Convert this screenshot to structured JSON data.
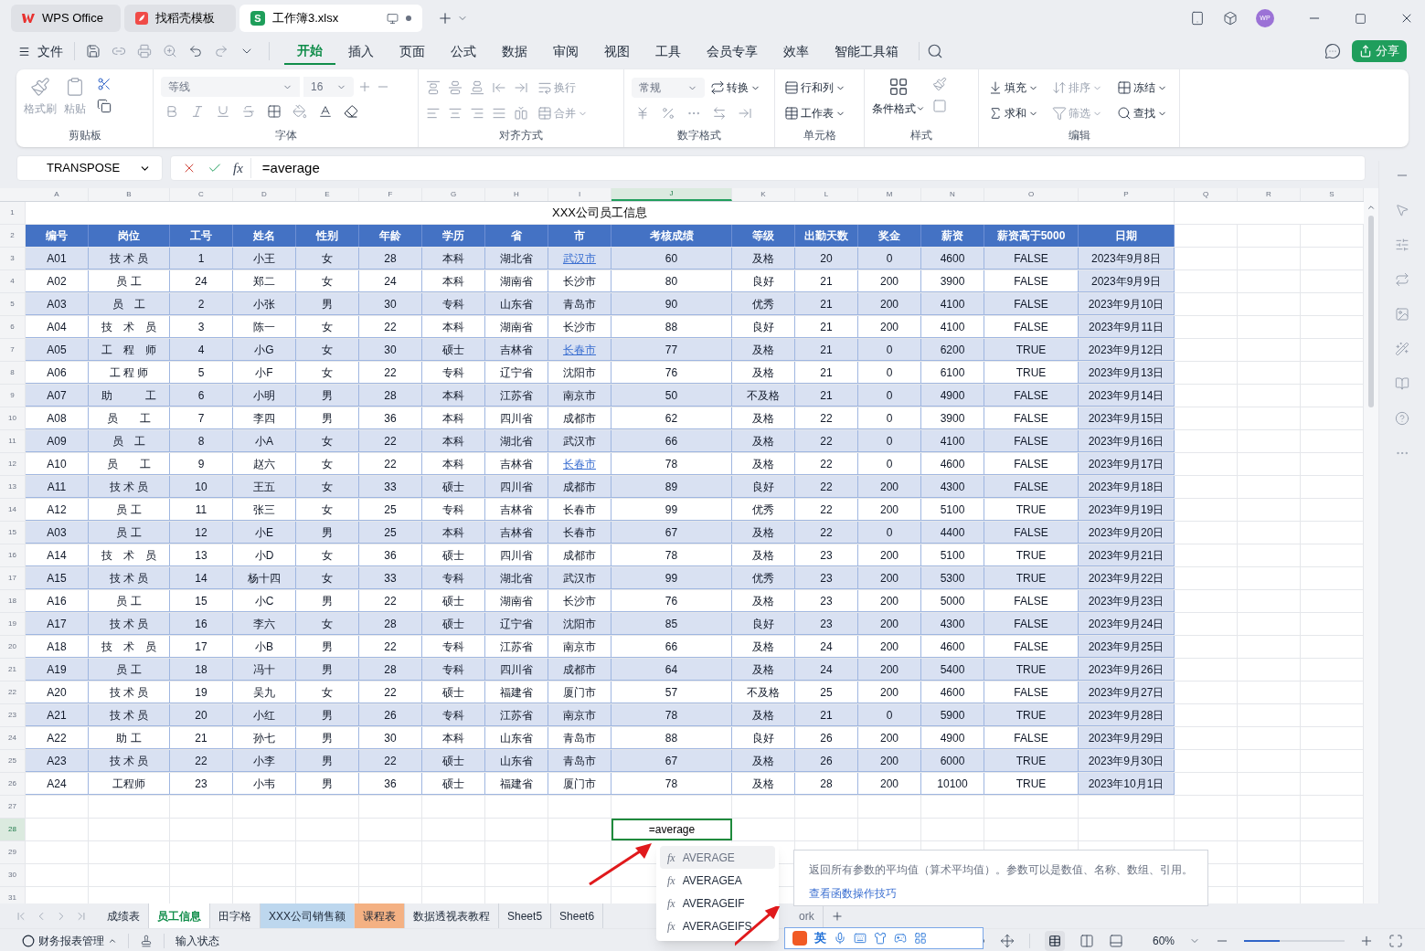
{
  "app_tabs": [
    {
      "label": "WPS Office",
      "selected": false,
      "kind": "wps"
    },
    {
      "label": "找稻壳模板",
      "selected": false,
      "kind": "docer"
    },
    {
      "label": "工作簿3.xlsx",
      "selected": true,
      "kind": "sheet",
      "badge": "S"
    }
  ],
  "avatar": "WP",
  "menu": {
    "file": "文件",
    "tabs": [
      {
        "label": "开始",
        "selected": true
      },
      {
        "label": "插入",
        "selected": false
      },
      {
        "label": "页面",
        "selected": false
      },
      {
        "label": "公式",
        "selected": false
      },
      {
        "label": "数据",
        "selected": false
      },
      {
        "label": "审阅",
        "selected": false
      },
      {
        "label": "视图",
        "selected": false
      },
      {
        "label": "工具",
        "selected": false
      },
      {
        "label": "会员专享",
        "selected": false
      },
      {
        "label": "效率",
        "selected": false
      },
      {
        "label": "智能工具箱",
        "selected": false
      }
    ],
    "share": "分享"
  },
  "ribbon": {
    "clipboard": {
      "title": "剪贴板",
      "format_painter": {
        "label": "格式刷",
        "disabled": true
      },
      "paste": {
        "label": "粘贴",
        "disabled": true
      }
    },
    "font": {
      "title": "字体",
      "font_name": "等线",
      "font_size": "16"
    },
    "alignment": {
      "title": "对齐方式",
      "wrap": {
        "label": "换行",
        "disabled": true
      },
      "merge": {
        "label": "合并",
        "disabled": true
      }
    },
    "number": {
      "title": "数字格式",
      "format": "常规",
      "convert": "转换"
    },
    "cells": {
      "title": "单元格",
      "rows_cols": "行和列",
      "worksheet": "工作表"
    },
    "styles": {
      "title": "样式",
      "conditional": "条件格式"
    },
    "editing": {
      "title": "编辑",
      "items": [
        {
          "label": "填充",
          "disabled": false
        },
        {
          "label": "排序",
          "disabled": true
        },
        {
          "label": "冻结",
          "disabled": false
        },
        {
          "label": "求和",
          "disabled": false
        },
        {
          "label": "筛选",
          "disabled": true
        },
        {
          "label": "查找",
          "disabled": false
        }
      ]
    }
  },
  "formula_bar": {
    "name_box": "TRANSPOSE",
    "fx": "fx",
    "formula": "=average"
  },
  "sheet": {
    "columns": [
      {
        "label": "A",
        "selected": false
      },
      {
        "label": "B",
        "selected": false
      },
      {
        "label": "C",
        "selected": false
      },
      {
        "label": "D",
        "selected": false
      },
      {
        "label": "E",
        "selected": false
      },
      {
        "label": "F",
        "selected": false
      },
      {
        "label": "G",
        "selected": false
      },
      {
        "label": "H",
        "selected": false
      },
      {
        "label": "I",
        "selected": false
      },
      {
        "label": "J",
        "selected": true
      },
      {
        "label": "K",
        "selected": false
      },
      {
        "label": "L",
        "selected": false
      },
      {
        "label": "M",
        "selected": false
      },
      {
        "label": "N",
        "selected": false
      },
      {
        "label": "O",
        "selected": false
      },
      {
        "label": "P",
        "selected": false
      },
      {
        "label": "Q",
        "selected": false
      },
      {
        "label": "R",
        "selected": false
      },
      {
        "label": "S",
        "selected": false
      }
    ],
    "row_numbers": [
      {
        "label": "1",
        "selected": false
      },
      {
        "label": "2",
        "selected": false
      },
      {
        "label": "3",
        "selected": false
      },
      {
        "label": "4",
        "selected": false
      },
      {
        "label": "5",
        "selected": false
      },
      {
        "label": "6",
        "selected": false
      },
      {
        "label": "7",
        "selected": false
      },
      {
        "label": "8",
        "selected": false
      },
      {
        "label": "9",
        "selected": false
      },
      {
        "label": "10",
        "selected": false
      },
      {
        "label": "11",
        "selected": false
      },
      {
        "label": "12",
        "selected": false
      },
      {
        "label": "13",
        "selected": false
      },
      {
        "label": "14",
        "selected": false
      },
      {
        "label": "15",
        "selected": false
      },
      {
        "label": "16",
        "selected": false
      },
      {
        "label": "17",
        "selected": false
      },
      {
        "label": "18",
        "selected": false
      },
      {
        "label": "19",
        "selected": false
      },
      {
        "label": "20",
        "selected": false
      },
      {
        "label": "21",
        "selected": false
      },
      {
        "label": "22",
        "selected": false
      },
      {
        "label": "23",
        "selected": false
      },
      {
        "label": "24",
        "selected": false
      },
      {
        "label": "25",
        "selected": false
      },
      {
        "label": "26",
        "selected": false
      },
      {
        "label": "27",
        "selected": false
      },
      {
        "label": "28",
        "selected": true
      },
      {
        "label": "29",
        "selected": false
      },
      {
        "label": "30",
        "selected": false
      },
      {
        "label": "31",
        "selected": false
      }
    ],
    "title": "XXX公司员工信息",
    "headers": [
      "编号",
      "岗位",
      "工号",
      "姓名",
      "性别",
      "年龄",
      "学历",
      "省",
      "市",
      "考核成绩",
      "等级",
      "出勤天数",
      "奖金",
      "薪资",
      "薪资高于5000",
      "日期"
    ],
    "rows": [
      {
        "cells": [
          "A01",
          "技 术 员",
          "1",
          "小王",
          "女",
          "28",
          "本科",
          "湖北省",
          "武汉市",
          "60",
          "及格",
          "20",
          "0",
          "4600",
          "FALSE",
          "2023年9月8日"
        ],
        "city_link": true
      },
      {
        "cells": [
          "A02",
          "员 工",
          "24",
          "郑二",
          "女",
          "24",
          "本科",
          "湖南省",
          "长沙市",
          "80",
          "良好",
          "21",
          "200",
          "3900",
          "FALSE",
          "2023年9月9日"
        ],
        "city_link": false
      },
      {
        "cells": [
          "A03",
          "员　工",
          "2",
          "小张",
          "男",
          "30",
          "专科",
          "山东省",
          "青岛市",
          "90",
          "优秀",
          "21",
          "200",
          "4100",
          "FALSE",
          "2023年9月10日"
        ],
        "city_link": false
      },
      {
        "cells": [
          "A04",
          "技　术　员",
          "3",
          "陈一",
          "女",
          "22",
          "本科",
          "湖南省",
          "长沙市",
          "88",
          "良好",
          "21",
          "200",
          "4100",
          "FALSE",
          "2023年9月11日"
        ],
        "city_link": false
      },
      {
        "cells": [
          "A05",
          "工　程　师",
          "4",
          "小G",
          "女",
          "30",
          "硕士",
          "吉林省",
          "长春市",
          "77",
          "及格",
          "21",
          "0",
          "6200",
          "TRUE",
          "2023年9月12日"
        ],
        "city_link": true
      },
      {
        "cells": [
          "A06",
          "工 程 师",
          "5",
          "小F",
          "女",
          "22",
          "专科",
          "辽宁省",
          "沈阳市",
          "76",
          "及格",
          "21",
          "0",
          "6100",
          "TRUE",
          "2023年9月13日"
        ],
        "city_link": false
      },
      {
        "cells": [
          "A07",
          "助　　　工",
          "6",
          "小明",
          "男",
          "28",
          "本科",
          "江苏省",
          "南京市",
          "50",
          "不及格",
          "21",
          "0",
          "4900",
          "FALSE",
          "2023年9月14日"
        ],
        "city_link": false
      },
      {
        "cells": [
          "A08",
          "员　　工",
          "7",
          "李四",
          "男",
          "36",
          "本科",
          "四川省",
          "成都市",
          "62",
          "及格",
          "22",
          "0",
          "3900",
          "FALSE",
          "2023年9月15日"
        ],
        "city_link": false
      },
      {
        "cells": [
          "A09",
          "员　工",
          "8",
          "小A",
          "女",
          "22",
          "本科",
          "湖北省",
          "武汉市",
          "66",
          "及格",
          "22",
          "0",
          "4100",
          "FALSE",
          "2023年9月16日"
        ],
        "city_link": false
      },
      {
        "cells": [
          "A10",
          "员　　工",
          "9",
          "赵六",
          "女",
          "22",
          "本科",
          "吉林省",
          "长春市",
          "78",
          "及格",
          "22",
          "0",
          "4600",
          "FALSE",
          "2023年9月17日"
        ],
        "city_link": true
      },
      {
        "cells": [
          "A11",
          "技 术 员",
          "10",
          "王五",
          "女",
          "33",
          "硕士",
          "四川省",
          "成都市",
          "89",
          "良好",
          "22",
          "200",
          "4300",
          "FALSE",
          "2023年9月18日"
        ],
        "city_link": false
      },
      {
        "cells": [
          "A12",
          "员 工",
          "11",
          "张三",
          "女",
          "25",
          "专科",
          "吉林省",
          "长春市",
          "99",
          "优秀",
          "22",
          "200",
          "5100",
          "TRUE",
          "2023年9月19日"
        ],
        "city_link": false
      },
      {
        "cells": [
          "A03",
          "员 工",
          "12",
          "小E",
          "男",
          "25",
          "本科",
          "吉林省",
          "长春市",
          "67",
          "及格",
          "22",
          "0",
          "4400",
          "FALSE",
          "2023年9月20日"
        ],
        "city_link": false
      },
      {
        "cells": [
          "A14",
          "技　术　员",
          "13",
          "小D",
          "女",
          "36",
          "硕士",
          "四川省",
          "成都市",
          "78",
          "及格",
          "23",
          "200",
          "5100",
          "TRUE",
          "2023年9月21日"
        ],
        "city_link": false
      },
      {
        "cells": [
          "A15",
          "技 术 员",
          "14",
          "杨十四",
          "女",
          "33",
          "专科",
          "湖北省",
          "武汉市",
          "99",
          "优秀",
          "23",
          "200",
          "5300",
          "TRUE",
          "2023年9月22日"
        ],
        "city_link": false
      },
      {
        "cells": [
          "A16",
          "员 工",
          "15",
          "小C",
          "男",
          "22",
          "硕士",
          "湖南省",
          "长沙市",
          "76",
          "及格",
          "23",
          "200",
          "5000",
          "FALSE",
          "2023年9月23日"
        ],
        "city_link": false
      },
      {
        "cells": [
          "A17",
          "技 术 员",
          "16",
          "李六",
          "女",
          "28",
          "硕士",
          "辽宁省",
          "沈阳市",
          "85",
          "良好",
          "23",
          "200",
          "4300",
          "FALSE",
          "2023年9月24日"
        ],
        "city_link": false
      },
      {
        "cells": [
          "A18",
          "技　术　员",
          "17",
          "小B",
          "男",
          "22",
          "专科",
          "江苏省",
          "南京市",
          "66",
          "及格",
          "24",
          "200",
          "4600",
          "FALSE",
          "2023年9月25日"
        ],
        "city_link": false
      },
      {
        "cells": [
          "A19",
          "员 工",
          "18",
          "冯十",
          "男",
          "28",
          "专科",
          "四川省",
          "成都市",
          "64",
          "及格",
          "24",
          "200",
          "5400",
          "TRUE",
          "2023年9月26日"
        ],
        "city_link": false
      },
      {
        "cells": [
          "A20",
          "技 术 员",
          "19",
          "吴九",
          "女",
          "22",
          "硕士",
          "福建省",
          "厦门市",
          "57",
          "不及格",
          "25",
          "200",
          "4600",
          "FALSE",
          "2023年9月27日"
        ],
        "city_link": false
      },
      {
        "cells": [
          "A21",
          "技 术 员",
          "20",
          "小红",
          "男",
          "26",
          "专科",
          "江苏省",
          "南京市",
          "78",
          "及格",
          "21",
          "0",
          "5900",
          "TRUE",
          "2023年9月28日"
        ],
        "city_link": false
      },
      {
        "cells": [
          "A22",
          "助 工",
          "21",
          "孙七",
          "男",
          "30",
          "本科",
          "山东省",
          "青岛市",
          "88",
          "良好",
          "26",
          "200",
          "4900",
          "FALSE",
          "2023年9月29日"
        ],
        "city_link": false
      },
      {
        "cells": [
          "A23",
          "技 术 员",
          "22",
          "小李",
          "男",
          "22",
          "硕士",
          "山东省",
          "青岛市",
          "67",
          "及格",
          "26",
          "200",
          "6000",
          "TRUE",
          "2023年9月30日"
        ],
        "city_link": false
      },
      {
        "cells": [
          "A24",
          "工程师",
          "23",
          "小韦",
          "男",
          "36",
          "硕士",
          "福建省",
          "厦门市",
          "78",
          "及格",
          "28",
          "200",
          "10100",
          "TRUE",
          "2023年10月1日"
        ],
        "city_link": false
      }
    ],
    "editing_cell": "=average"
  },
  "autocomplete": [
    {
      "icon": "fx",
      "name": "AVERAGE",
      "selected": true
    },
    {
      "icon": "fx",
      "name": "AVERAGEA",
      "selected": false
    },
    {
      "icon": "fx",
      "name": "AVERAGEIF",
      "selected": false
    },
    {
      "icon": "fx",
      "name": "AVERAGEIFS",
      "selected": false
    }
  ],
  "function_tip": {
    "text": "返回所有参数的平均值（算术平均值）。参数可以是数值、名称、数组、引用。",
    "link": "查看函数操作技巧"
  },
  "sheet_tabs": [
    {
      "label": "成绩表",
      "selected": false
    },
    {
      "label": "员工信息",
      "selected": true
    },
    {
      "label": "田字格",
      "selected": false
    },
    {
      "label": "XXX公司销售额",
      "selected": false,
      "color": "#bdd7ee"
    },
    {
      "label": "课程表",
      "selected": false,
      "color": "#f4b183"
    },
    {
      "label": "数据透视表教程",
      "selected": false
    },
    {
      "label": "Sheet5",
      "selected": false
    },
    {
      "label": "Sheet6",
      "selected": false
    },
    {
      "label": "ork",
      "selected": false
    }
  ],
  "ime": {
    "mode": "英"
  },
  "status_bar": {
    "workbook_tool": "财务报表管理",
    "input_state": "输入状态",
    "zoom": "60%",
    "zoom_level": {
      "level": 0.35
    }
  }
}
